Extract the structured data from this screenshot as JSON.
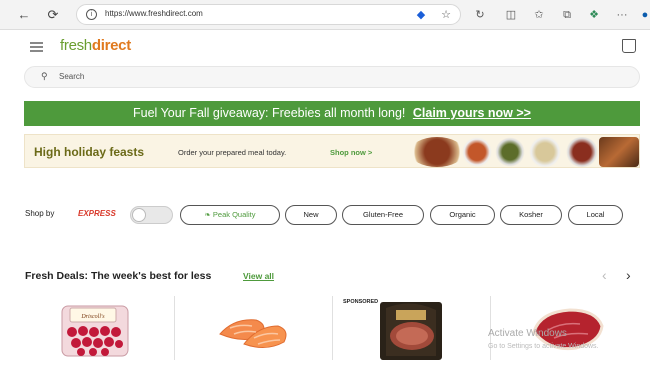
{
  "browser": {
    "url": "https://www.freshdirect.com"
  },
  "header": {
    "logo_prefix": "fresh",
    "logo_suffix": "direct"
  },
  "search": {
    "placeholder": "Search"
  },
  "promo": {
    "text": "Fuel Your Fall giveaway: Freebies all month long!",
    "cta": "Claim yours now >>"
  },
  "holiday": {
    "title": "High holiday feasts",
    "subtitle": "Order your prepared meal today.",
    "link": "Shop now >"
  },
  "filters": {
    "label": "Shop by",
    "express": "EXPRESS",
    "chips": [
      "Peak Quality",
      "New",
      "Gluten-Free",
      "Organic",
      "Kosher",
      "Local"
    ]
  },
  "deals": {
    "title": "Fresh Deals: The week's best for less",
    "view_all": "View all",
    "sponsored": "SPONSORED",
    "products": [
      "Driscoll's raspberries",
      "Salmon fillets",
      "Sponsored wrapped meat",
      "Steak"
    ]
  },
  "watermark": {
    "title": "Activate Windows",
    "subtitle": "Go to Settings to activate Windows."
  },
  "colors": {
    "brand_green": "#4e9a3c",
    "express_red": "#d9392b"
  }
}
